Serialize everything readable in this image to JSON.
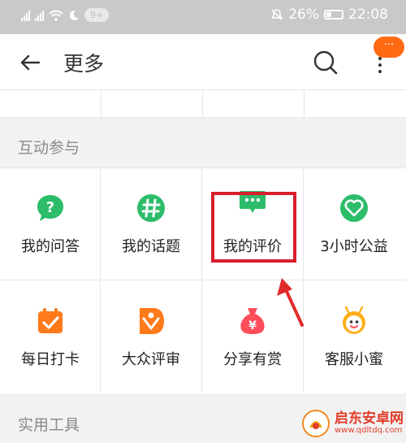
{
  "status_bar": {
    "signal_label": "4G",
    "notification_count": "9+",
    "battery": "26%",
    "time": "22:08"
  },
  "header": {
    "title": "更多",
    "more_badge": "···"
  },
  "sections": {
    "interaction_title": "互动参与",
    "tools_title": "实用工具"
  },
  "grid": [
    {
      "label": "我的问答",
      "icon": "question-icon",
      "color": "#2dbd6a"
    },
    {
      "label": "我的话题",
      "icon": "hashtag-icon",
      "color": "#2dbd6a"
    },
    {
      "label": "我的评价",
      "icon": "comment-icon",
      "color": "#2dbd6a"
    },
    {
      "label": "3小时公益",
      "icon": "heart-icon",
      "color": "#2dbd6a"
    },
    {
      "label": "每日打卡",
      "icon": "checkin-icon",
      "color": "#ff7a1a"
    },
    {
      "label": "大众评审",
      "icon": "judge-icon",
      "color": "#ff7a1a"
    },
    {
      "label": "分享有赏",
      "icon": "money-bag-icon",
      "color": "#ff4d5a"
    },
    {
      "label": "客服小蜜",
      "icon": "bee-icon",
      "color": "#ffae1a"
    }
  ],
  "watermark": {
    "name": "启东安卓网",
    "url": "www.qdltdq.com"
  },
  "colors": {
    "accent_orange": "#ff6a13",
    "highlight_red": "#d81e2b",
    "green": "#2dbd6a"
  }
}
